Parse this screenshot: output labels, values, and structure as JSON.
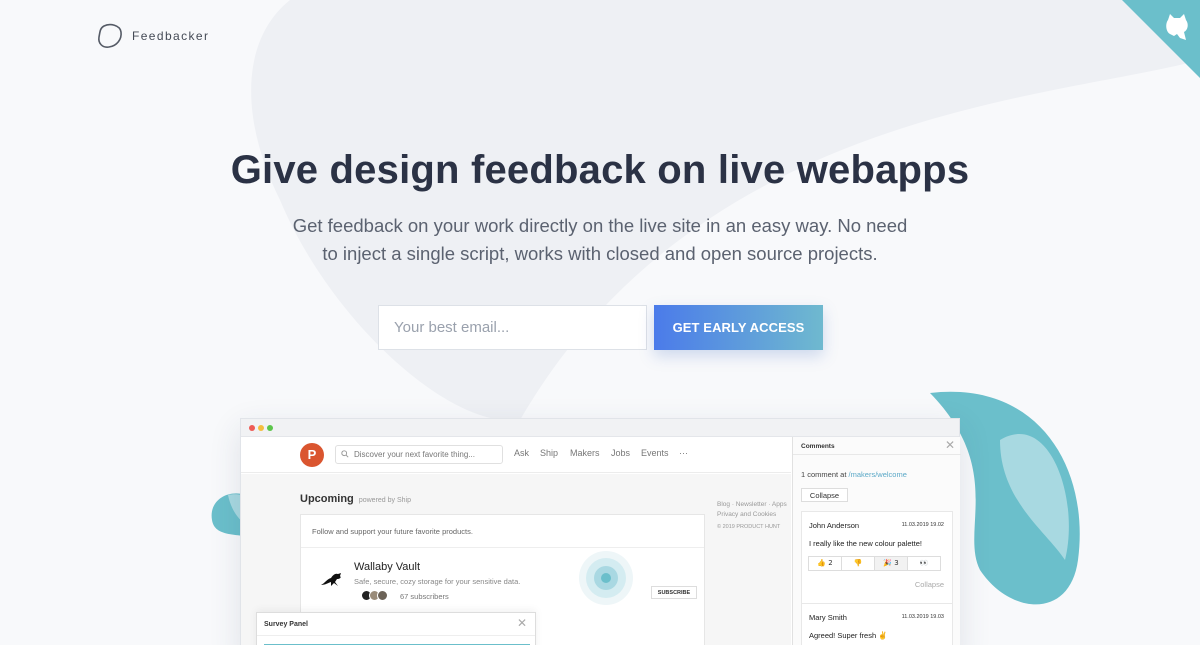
{
  "brand": {
    "name": "Feedbacker",
    "logo_icon": "pebble-outline-icon",
    "corner_icon": "github-octocat-icon",
    "accent": "#6bbfcb"
  },
  "hero": {
    "title": "Give design feedback on live webapps",
    "subtitle": "Get feedback on your work directly on the live site in an easy way. No need to inject a single script, works with closed and open source projects."
  },
  "signup": {
    "email_placeholder": "Your best email...",
    "email_value": "",
    "cta_label": "GET EARLY ACCESS",
    "cta_gradient": [
      "#4b7bea",
      "#6fb9cf"
    ]
  },
  "mockup": {
    "site": {
      "logo_letter": "P",
      "search_placeholder": "Discover your next favorite thing...",
      "nav": [
        "Ask",
        "Ship",
        "Makers",
        "Jobs",
        "Events",
        "···"
      ],
      "section_title": "Upcoming",
      "section_powered": "powered by Ship",
      "footer_links": "Blog · Newsletter · Apps",
      "footer_links_2": "Privacy and Cookies",
      "copyright": "© 2019 PRODUCT HUNT",
      "card_header": "Follow and support your future favorite products.",
      "product": {
        "name": "Wallaby Vault",
        "description": "Safe, secure, cozy storage for your sensitive data.",
        "subscribers": "67 subscribers",
        "subscribe_label": "SUBSCRIBE",
        "icon": "kangaroo-icon"
      }
    },
    "survey": {
      "title": "Survey Panel"
    },
    "comments": {
      "title": "Comments",
      "count_text": "1 comment at ",
      "count_link": "/makers/welcome",
      "collapse_button": "Collapse",
      "items": [
        {
          "author": "John Anderson",
          "date": "11.03.2019 19.02",
          "text": "I really like the new colour palette!",
          "reactions": [
            {
              "emoji": "👍",
              "count": "2"
            },
            {
              "emoji": "👎",
              "count": ""
            },
            {
              "emoji": "🎉",
              "count": "3"
            },
            {
              "emoji": "👀",
              "count": ""
            }
          ],
          "collapse_link": "Collapse"
        },
        {
          "author": "Mary Smith",
          "date": "11.03.2019 19.03",
          "text": "Agreed! Super fresh ✌️"
        }
      ]
    }
  }
}
